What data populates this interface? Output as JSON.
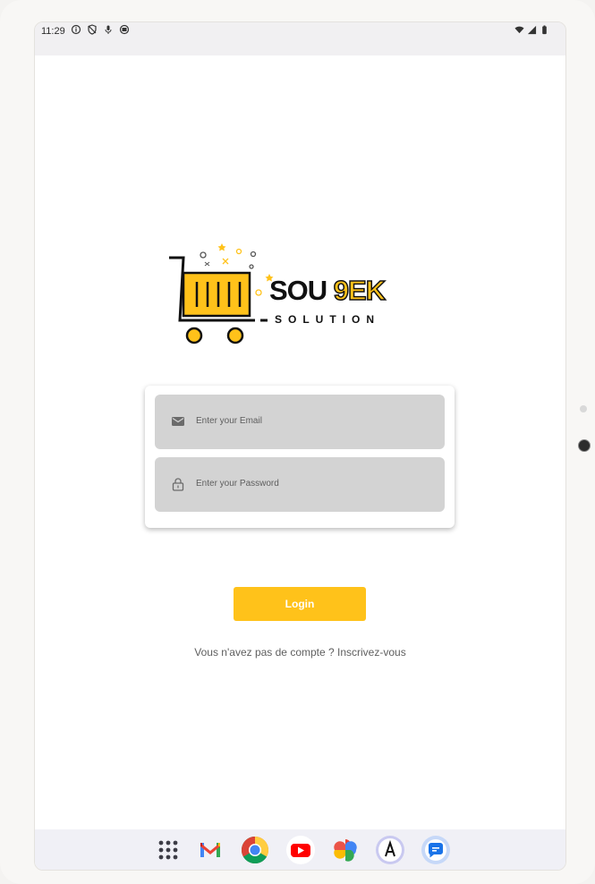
{
  "status_bar": {
    "time": "11:29",
    "left_icons": [
      "info-icon",
      "shield-off-icon",
      "mic-icon",
      "recording-icon"
    ],
    "right_icons": [
      "wifi-icon",
      "signal-icon",
      "battery-icon"
    ]
  },
  "logo": {
    "title_part1": "SOU ",
    "title_part2": "9EK",
    "subtitle": "SOLUTION",
    "accent_color": "#ffc21a"
  },
  "login_form": {
    "email": {
      "placeholder": "Enter your Email",
      "value": "",
      "icon": "mail-icon"
    },
    "password": {
      "placeholder": "Enter your Password",
      "value": "",
      "icon": "lock-icon"
    },
    "login_label": "Login",
    "signup_text": "Vous n'avez pas de compte ? Inscrivez-vous"
  },
  "dock": {
    "apps": [
      "app-drawer-icon",
      "gmail-icon",
      "chrome-icon",
      "youtube-icon",
      "photos-icon",
      "app-icon",
      "messages-icon"
    ]
  },
  "colors": {
    "accent": "#ffc21a",
    "field_bg": "#d3d3d3",
    "screen_bg": "#ffffff"
  }
}
